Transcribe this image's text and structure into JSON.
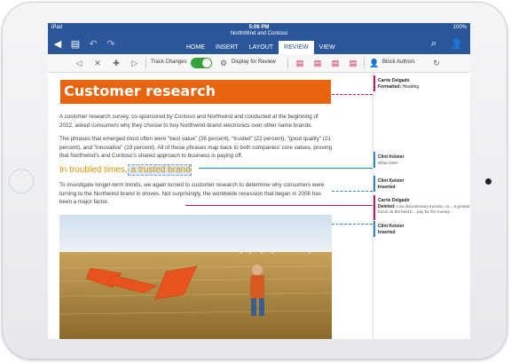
{
  "status_bar": {
    "carrier": "iPad",
    "time": "5:06 PM",
    "battery": "100%"
  },
  "app": {
    "document_title": "NorthWind and Contoso"
  },
  "ribbon": {
    "tabs": [
      {
        "label": "HOME",
        "active": false
      },
      {
        "label": "INSERT",
        "active": false
      },
      {
        "label": "LAYOUT",
        "active": false
      },
      {
        "label": "REVIEW",
        "active": true
      },
      {
        "label": "VIEW",
        "active": false
      }
    ],
    "quick_icons": [
      "back-icon",
      "file-icon",
      "undo-icon",
      "redo-icon"
    ],
    "right_icons": [
      "search-icon",
      "share-person-icon"
    ]
  },
  "toolbar": {
    "track_changes_label": "Track Changes",
    "track_changes_on": true,
    "display_for_review_label": "Display for Review",
    "block_authors_label": "Block Authors"
  },
  "document": {
    "heading": "Customer research",
    "para1": "A customer research survey, co-sponsored by Contoso and Northwind and conducted at the beginning of 2012, asked consumers why they choose to buy Northwind-brand electronics over other name brands.",
    "para2": "The phrases that emerged most often were “best value” (26 percent), “trusted” (22 percent), “good quality” (21 percent), and “innovative” (19 percent). All of these phrases map back to both companies’ core values, proving that Northwind’s and Contoso’s shared approach to business is paying off.",
    "subheading_pre": "In troubled times,",
    "subheading_inserted": " a trusted brand",
    "para3": "To investigate longer-term trends, we again turned to customer research to determine why consumers were turning to the Northwind brand in droves. Not surprisingly, the worldwide recession that began in 2008 has been a major factor."
  },
  "comments": [
    {
      "author": "Carrie Delgado",
      "action": "Formatted:",
      "text": "Heading",
      "color": "#c2185b"
    },
    {
      "author": "Clint Keister",
      "action": "",
      "text": "What else?",
      "color": "#2e86c1"
    },
    {
      "author": "Clint Keister",
      "action": "Inserted",
      "text": "",
      "color": "#2e86c1"
    },
    {
      "author": "Carrie Delgado",
      "action": "Deleted:",
      "text": "Low discretionary income, co... a greater focus on the best b... pay for the money.",
      "color": "#c2185b"
    },
    {
      "author": "Clint Keister",
      "action": "Inserted",
      "text": "",
      "color": "#2e86c1"
    }
  ],
  "colors": {
    "ribbon": "#2b579a",
    "heading_fill": "#e8640f",
    "subheading": "#d49400",
    "toggle_on": "#33a23b"
  }
}
